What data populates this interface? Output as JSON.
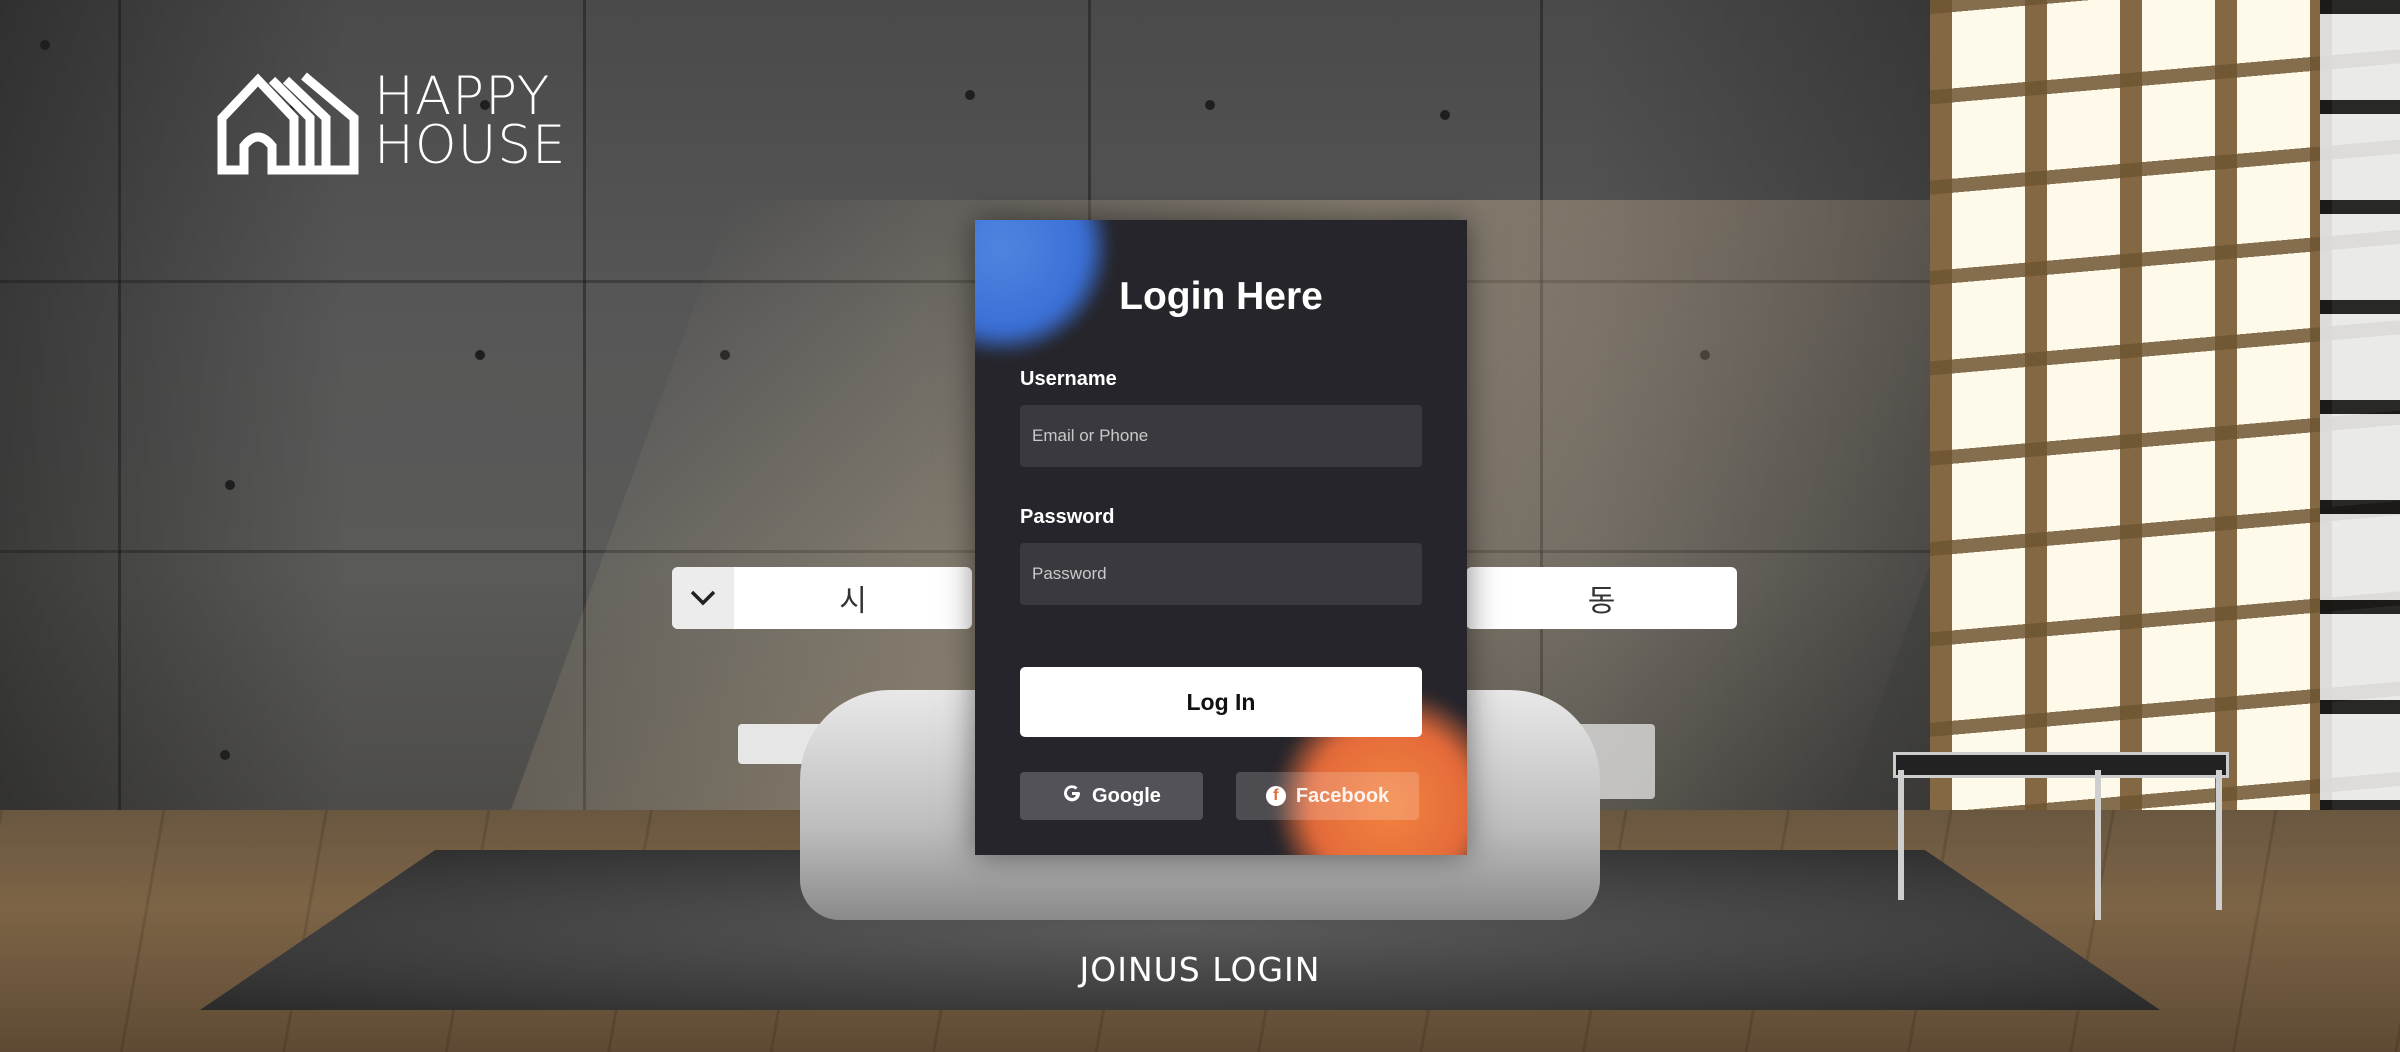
{
  "brand": {
    "line1": "HAPPY",
    "line2": "HOUSE"
  },
  "location_select": {
    "city_label": "시",
    "dong_label": "동"
  },
  "login": {
    "title": "Login Here",
    "username_label": "Username",
    "username_placeholder": "Email or Phone",
    "password_label": "Password",
    "password_placeholder": "Password",
    "submit_label": "Log In",
    "google_label": "Google",
    "facebook_label": "Facebook"
  },
  "footer": {
    "join_label": "JOINUS",
    "login_label": "LOGIN"
  },
  "colors": {
    "card_bg": "#26252b",
    "input_bg": "#3a393f",
    "accent_blue": "#3a6fd6",
    "accent_orange": "#e46a3a"
  }
}
